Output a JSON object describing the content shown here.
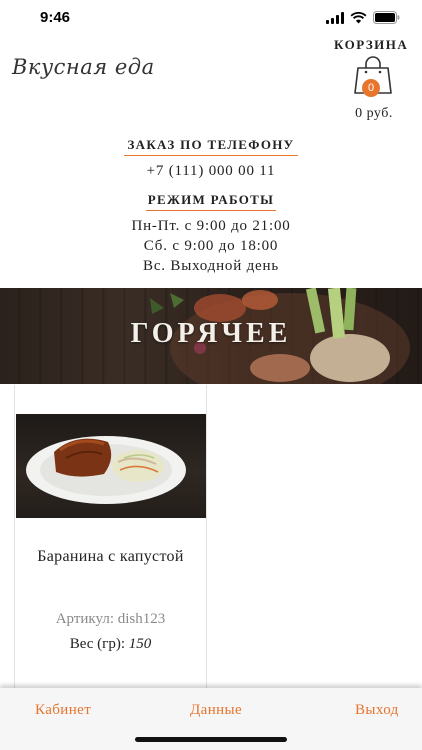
{
  "status": {
    "time": "9:46",
    "icons": [
      "signal-icon",
      "wifi-icon",
      "battery-icon"
    ]
  },
  "header": {
    "logo_text": "Вкусная еда",
    "cart": {
      "title": "КОРЗИНА",
      "count": "0",
      "total": "0 руб."
    }
  },
  "info": {
    "phone_heading": "ЗАКАЗ ПО ТЕЛЕФОНУ",
    "phone": "+7 (111) 000 00 11",
    "hours_heading": "РЕЖИМ РАБОТЫ",
    "hours": [
      "Пн-Пт. с 9:00 до 21:00",
      "Сб. с 9:00 до 18:00",
      "Вс. Выходной день"
    ]
  },
  "category": {
    "title": "ГОРЯЧЕЕ"
  },
  "products": [
    {
      "name": "Баранина с капустой",
      "sku": "Артикул: dish123",
      "weight_label": "Вес (гр):",
      "weight_value": "150"
    }
  ],
  "bottom_nav": {
    "cabinet": "Кабинет",
    "data": "Данные",
    "exit": "Выход"
  },
  "colors": {
    "accent": "#e8752e",
    "text": "#222222",
    "muted": "#8a8a8a",
    "nav_bg": "#f6f6f6"
  }
}
